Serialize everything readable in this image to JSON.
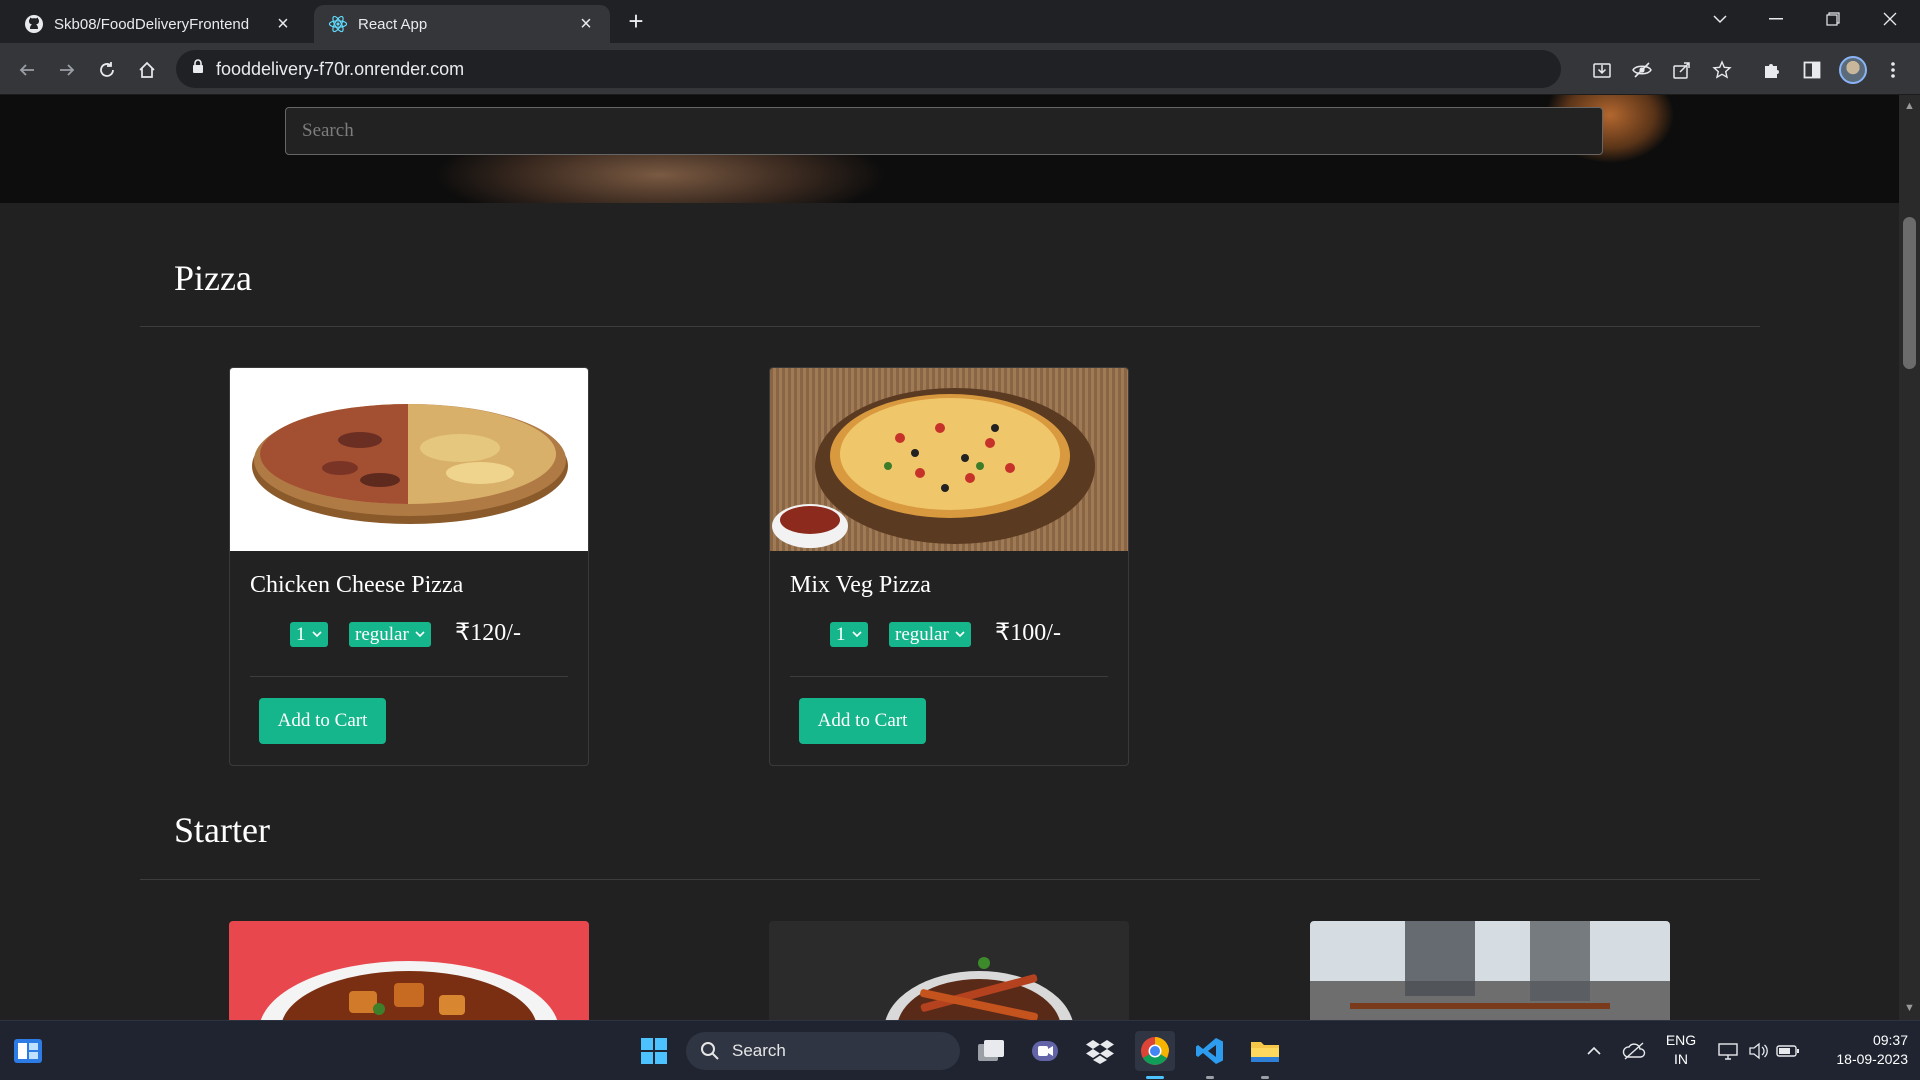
{
  "browser": {
    "tabs": [
      {
        "title": "Skb08/FoodDeliveryFrontend",
        "icon": "github-icon"
      },
      {
        "title": "React App",
        "icon": "react-icon"
      }
    ],
    "url": "fooddelivery-f70r.onrender.com"
  },
  "page": {
    "search": {
      "placeholder": "Search"
    },
    "sections": [
      {
        "title": "Pizza",
        "items": [
          {
            "name": "Chicken Cheese Pizza",
            "qty": "1",
            "size": "regular",
            "price": "₹120/-",
            "button": "Add to Cart"
          },
          {
            "name": "Mix Veg Pizza",
            "qty": "1",
            "size": "regular",
            "price": "₹100/-",
            "button": "Add to Cart"
          }
        ]
      },
      {
        "title": "Starter",
        "items": []
      }
    ],
    "accent_color": "#16b68c"
  },
  "taskbar": {
    "search_label": "Search",
    "lang_top": "ENG",
    "lang_bottom": "IN",
    "time": "09:37",
    "date": "18-09-2023"
  }
}
